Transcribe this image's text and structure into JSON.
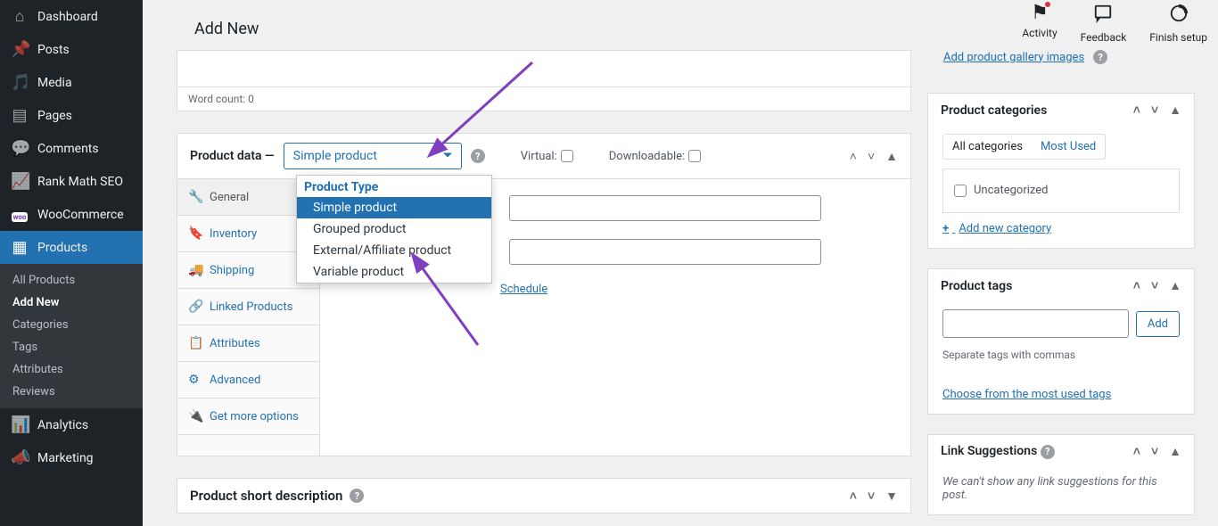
{
  "header": {
    "title": "Add New",
    "actions": {
      "activity": "Activity",
      "feedback": "Feedback",
      "finish": "Finish setup"
    }
  },
  "sidebar": {
    "items": [
      {
        "label": "Dashboard",
        "icon": "gauge"
      },
      {
        "label": "Posts",
        "icon": "pin"
      },
      {
        "label": "Media",
        "icon": "media"
      },
      {
        "label": "Pages",
        "icon": "page"
      },
      {
        "label": "Comments",
        "icon": "chat"
      },
      {
        "label": "Rank Math SEO",
        "icon": "chart"
      },
      {
        "label": "WooCommerce",
        "icon": "woo"
      },
      {
        "label": "Products",
        "icon": "package",
        "active": true,
        "submenu": [
          {
            "label": "All Products"
          },
          {
            "label": "Add New",
            "current": true
          },
          {
            "label": "Categories"
          },
          {
            "label": "Tags"
          },
          {
            "label": "Attributes"
          },
          {
            "label": "Reviews"
          }
        ]
      },
      {
        "label": "Analytics",
        "icon": "bars"
      },
      {
        "label": "Marketing",
        "icon": "mega"
      }
    ]
  },
  "editor": {
    "word_count_label": "Word count: 0"
  },
  "product_data": {
    "title": "Product data",
    "dash": " — ",
    "select_value": "Simple product",
    "virtual_label": "Virtual:",
    "download_label": "Downloadable:",
    "dropdown": {
      "group_label": "Product Type",
      "options": [
        "Simple product",
        "Grouped product",
        "External/Affiliate product",
        "Variable product"
      ],
      "selected_index": 0
    },
    "vtabs": [
      {
        "label": "General",
        "icon": "🔧"
      },
      {
        "label": "Inventory",
        "icon": "🔖"
      },
      {
        "label": "Shipping",
        "icon": "🚚"
      },
      {
        "label": "Linked Products",
        "icon": "🔗"
      },
      {
        "label": "Attributes",
        "icon": "📋"
      },
      {
        "label": "Advanced",
        "icon": "⚙"
      },
      {
        "label": "Get more options",
        "icon": "🔌"
      }
    ],
    "schedule_label": "Schedule"
  },
  "short_desc": {
    "title": "Product short description"
  },
  "gallery": {
    "add_label": "Add product gallery images"
  },
  "categories": {
    "title": "Product categories",
    "tab_all": "All categories",
    "tab_used": "Most Used",
    "items": [
      "Uncategorized"
    ],
    "add_new": "Add new category"
  },
  "tags": {
    "title": "Product tags",
    "add_btn": "Add",
    "hint": "Separate tags with commas",
    "choose": "Choose from the most used tags"
  },
  "linksug": {
    "title": "Link Suggestions",
    "hint": "We can't show any link suggestions for this post."
  }
}
